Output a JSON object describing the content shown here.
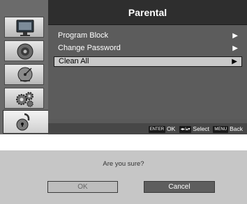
{
  "menu": {
    "title": "Parental",
    "items": [
      {
        "label": "Program Block",
        "arrow": "▶"
      },
      {
        "label": "Change Password",
        "arrow": "▶"
      },
      {
        "label": "Clean All",
        "arrow": "▶"
      }
    ],
    "selected_index": 2
  },
  "sidebar": {
    "icons": [
      "picture-icon",
      "sound-icon",
      "channel-icon",
      "setup-icon",
      "parental-lock-icon"
    ],
    "active_index": 4
  },
  "guide": {
    "enter_key": "ENTER",
    "enter_label": "OK",
    "nav_key": "◂▸/▴▾",
    "nav_label": "Select",
    "menu_key": "MENU",
    "menu_label": "Back"
  },
  "dialog": {
    "question": "Are you sure?",
    "ok_label": "OK",
    "cancel_label": "Cancel",
    "focused": "Cancel"
  },
  "colors": {
    "panel_bg": "#5a5a5a",
    "title_bg": "#2e2e2e",
    "selected_bg": "#c9c9c9",
    "dialog_bg": "#c6c6c6",
    "focused_button_bg": "#5e5e5e"
  }
}
